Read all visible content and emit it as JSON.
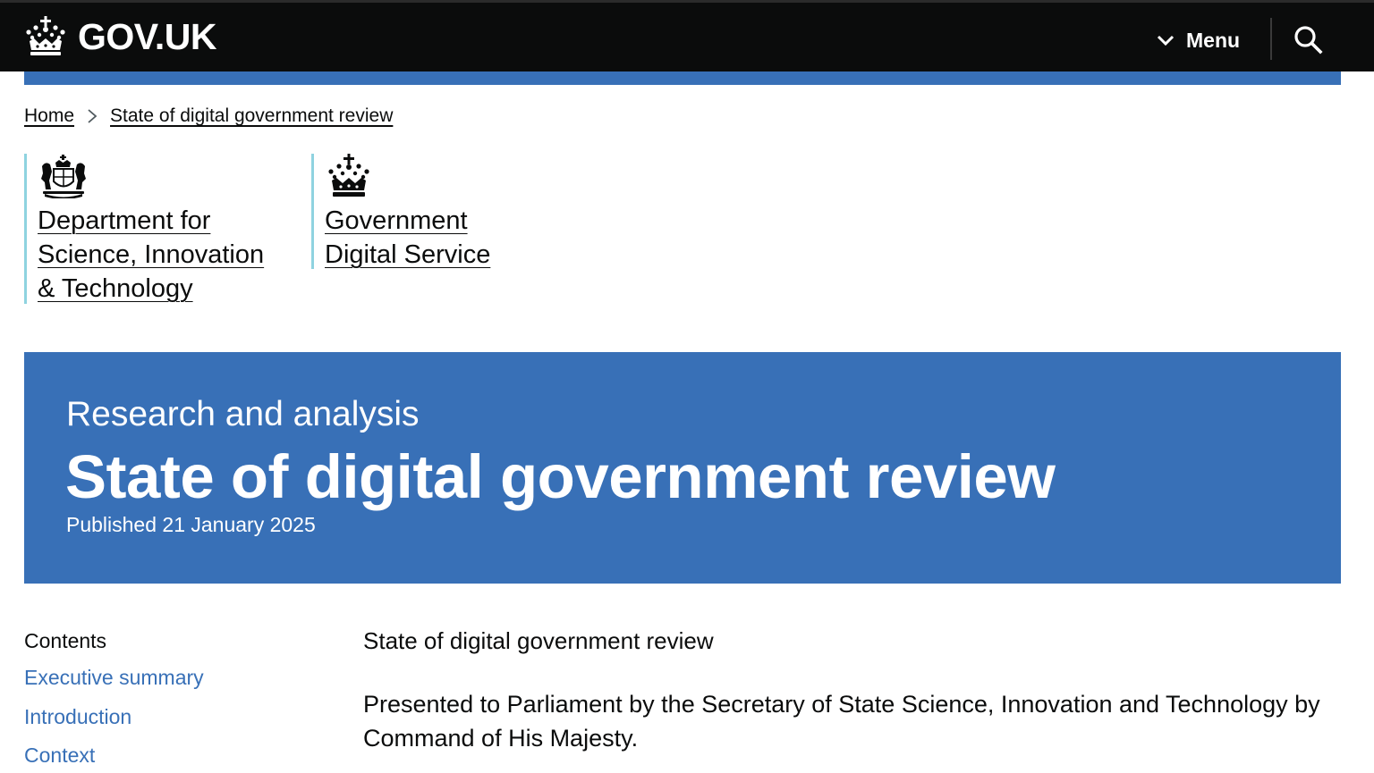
{
  "header": {
    "logo_text": "GOV.UK",
    "menu_label": "Menu",
    "background": "#0b0c0c",
    "accent": "#3870b7"
  },
  "breadcrumb": {
    "items": [
      "Home",
      "State of digital government review"
    ]
  },
  "organisations": [
    {
      "name": "Department for Science, Innovation & Technology",
      "icon": "royal-coat-of-arms-icon"
    },
    {
      "name": "Government Digital Service",
      "icon": "crown-icon"
    }
  ],
  "banner": {
    "document_type": "Research and analysis",
    "title": "State of digital government review",
    "published": "Published 21 January 2025",
    "background": "#3870b7"
  },
  "contents": {
    "heading": "Contents",
    "items": [
      "Executive summary",
      "Introduction",
      "Context"
    ]
  },
  "body": {
    "title": "State of digital government review",
    "paragraph": "Presented to Parliament by the Secretary of State Science, Innovation and Technology by Command of His Majesty."
  }
}
